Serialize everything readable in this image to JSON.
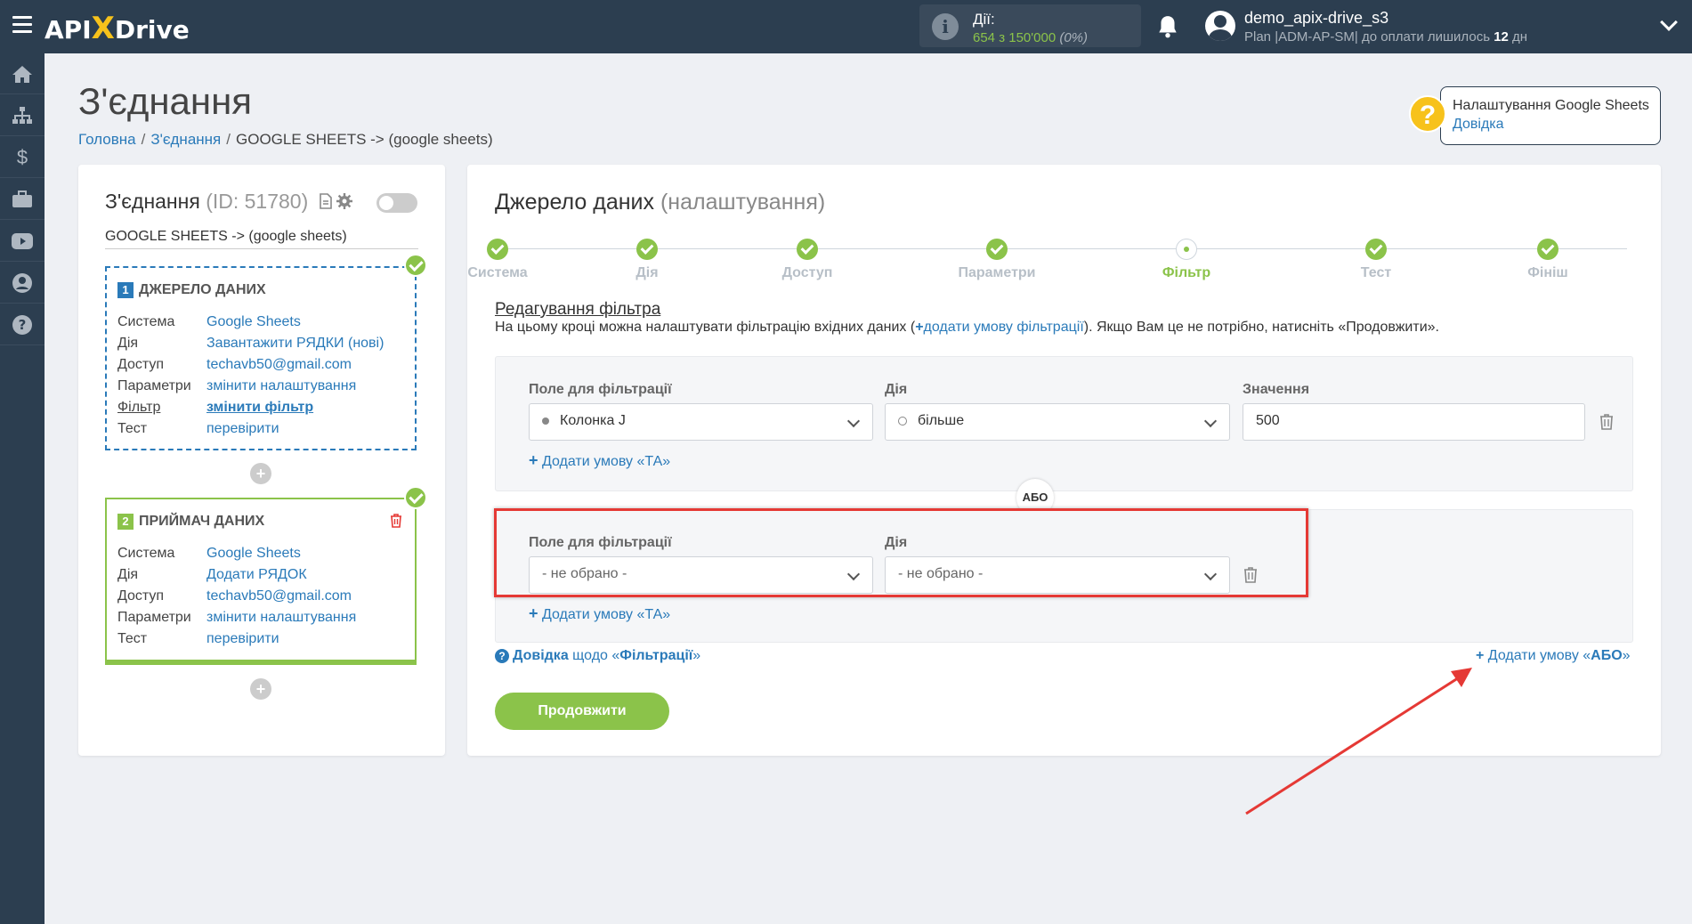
{
  "topbar": {
    "logo_api": "API",
    "logo_x": "X",
    "logo_drive": "Drive",
    "actions_label": "Дії:",
    "actions_value": "654 з 150'000",
    "actions_pct": "(0%)",
    "user_name": "demo_apix-drive_s3",
    "plan_text": "Plan |ADM-AP-SM| до оплати лишилось",
    "plan_days": "12",
    "plan_days_unit": "дн"
  },
  "header": {
    "title": "З'єднання",
    "breadcrumb": [
      "Головна",
      "З'єднання",
      "GOOGLE SHEETS -> (google sheets)"
    ],
    "help_title": "Налаштування Google Sheets",
    "help_link": "Довідка"
  },
  "connection": {
    "title": "З'єднання",
    "id": "(ID: 51780)",
    "subtitle": "GOOGLE SHEETS -> (google sheets)",
    "source": {
      "num": "1",
      "title": "ДЖЕРЕЛО ДАНИХ",
      "rows": [
        {
          "k": "Система",
          "v": "Google Sheets"
        },
        {
          "k": "Дія",
          "v": "Завантажити РЯДКИ (нові)"
        },
        {
          "k": "Доступ",
          "v": "techavb50@gmail.com"
        },
        {
          "k": "Параметри",
          "v": "змінити налаштування"
        },
        {
          "k": "Фільтр",
          "v": "змінити фільтр"
        },
        {
          "k": "Тест",
          "v": "перевірити"
        }
      ]
    },
    "receiver": {
      "num": "2",
      "title": "ПРИЙМАЧ ДАНИХ",
      "rows": [
        {
          "k": "Система",
          "v": "Google Sheets"
        },
        {
          "k": "Дія",
          "v": "Додати РЯДОК"
        },
        {
          "k": "Доступ",
          "v": "techavb50@gmail.com"
        },
        {
          "k": "Параметри",
          "v": "змінити налаштування"
        },
        {
          "k": "Тест",
          "v": "перевірити"
        }
      ]
    }
  },
  "main": {
    "title": "Джерело даних",
    "title_suffix": "(налаштування)",
    "steps": [
      "Система",
      "Дія",
      "Доступ",
      "Параметри",
      "Фільтр",
      "Тест",
      "Фініш"
    ],
    "edit_title": "Редагування фільтра",
    "edit_desc_pre": "На цьому кроці можна налаштувати фільтрацію вхідних даних (",
    "edit_desc_link": "додати умову фільтрації",
    "edit_desc_post": "). Якщо Вам це не потрібно, натисніть «Продовжити».",
    "label_field": "Поле для фільтрації",
    "label_action": "Дія",
    "label_value": "Значення",
    "group1": {
      "field": "Колонка J",
      "action": "більше",
      "value": "500"
    },
    "group2": {
      "field": "- не обрано -",
      "action": "- не обрано -"
    },
    "add_and": "Додати умову «ТА»",
    "or_label": "АБО",
    "help_pre": "Довідка",
    "help_mid": "щодо «",
    "help_bold": "Фільтрації",
    "help_end": "»",
    "add_or_pre": "Додати умову «",
    "add_or_bold": "АБО",
    "add_or_end": "»",
    "continue": "Продовжити"
  }
}
